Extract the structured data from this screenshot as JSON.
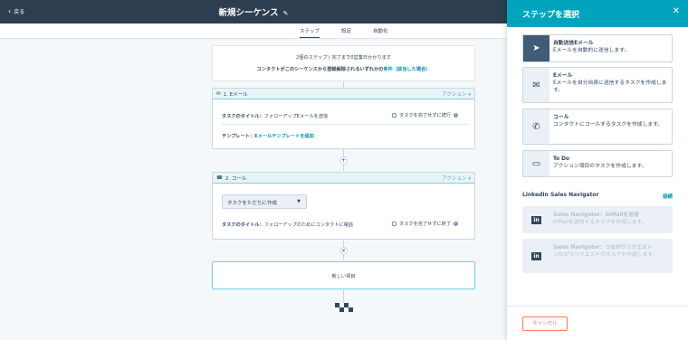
{
  "header": {
    "back_label": "戻る",
    "title": "新規シーケンス"
  },
  "tabs": [
    "ステップ",
    "設定",
    "自動化"
  ],
  "info": {
    "line1": "2個のステップ | 完了まで0営業日かかります",
    "line2_prefix": "コンタクトがこのシーケンスから登録解除されるいずれかの",
    "line2_link": "条件（該当した場合）"
  },
  "steps": [
    {
      "label": "1. Eメール",
      "action": "アクション",
      "task_title_label": "タスクのタイトル：",
      "task_title_value": "フォローアップEメールを送信",
      "checkbox_label": "タスクを完了せずに続行",
      "template_label": "テンプレート：",
      "template_link": "Eメールテンプレートを追加"
    },
    {
      "label": "2. コール",
      "action": "アクション",
      "dropdown_value": "タスクをただちに作成",
      "task_title_label": "タスクのタイトル：",
      "task_title_value": "フォローアップのためにコンタクトに電話",
      "checkbox_label": "タスクを完了せずに終了"
    }
  ],
  "new_item_label": "新しい項目",
  "panel": {
    "title": "ステップを選択",
    "options": [
      {
        "title": "自動送信Eメール",
        "desc": "Eメールを自動的に送信します。",
        "icon": "send-icon"
      },
      {
        "title": "Eメール",
        "desc": "Eメールを自分自身に送信するタスクを作成します。",
        "icon": "envelope-icon"
      },
      {
        "title": "コール",
        "desc": "コンタクトにコールするタスクを作成します。",
        "icon": "phone-icon"
      },
      {
        "title": "To Do",
        "desc": "アクション項目のタスクを作成します。",
        "icon": "todo-icon"
      }
    ],
    "linkedin_heading": "LinkedIn Sales Navigator",
    "linkedin_link": "接続",
    "linkedin_options": [
      {
        "title": "Sales Navigator：InMailを送信",
        "desc": "InMailを送信するタスクを作成します。"
      },
      {
        "title": "Sales Navigator：つながりリクエスト",
        "desc": "つながりリクエストのタスクを作成します。"
      }
    ],
    "cancel_label": "キャンセル"
  },
  "colors": {
    "accent": "#00a4bd",
    "topbar": "#2d3e50",
    "cancel": "#ff7a59"
  }
}
